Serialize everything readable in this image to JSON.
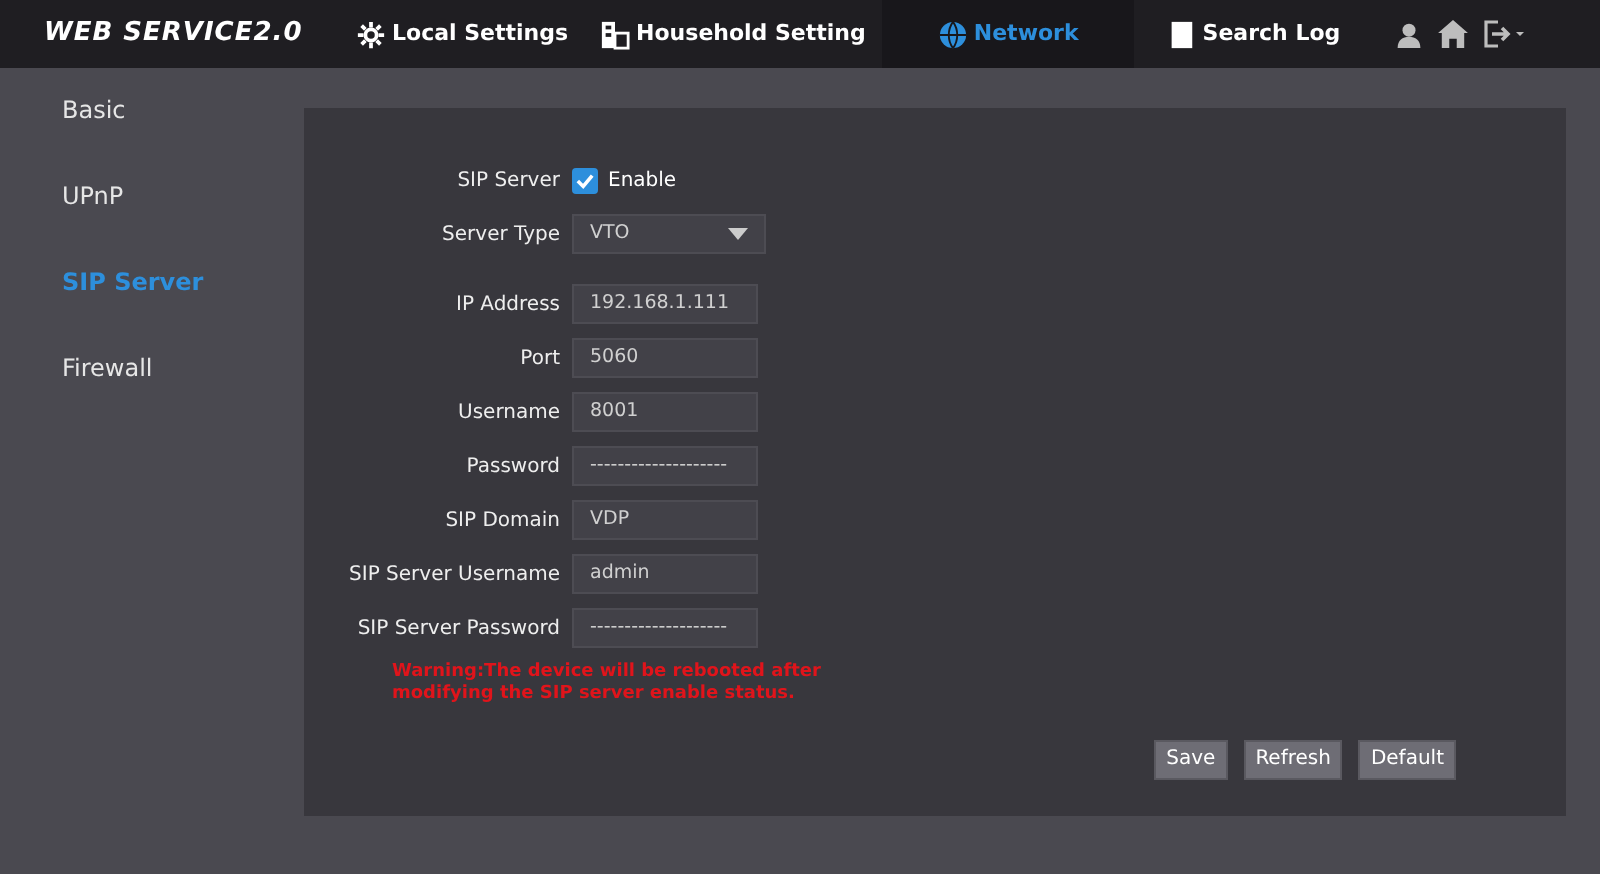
{
  "brand": "WEB SERVICE2.0",
  "nav": [
    {
      "label": "Local Settings",
      "selected": false
    },
    {
      "label": "Household Setting",
      "selected": false
    },
    {
      "label": "Network",
      "selected": true
    },
    {
      "label": "Search Log",
      "selected": false
    }
  ],
  "sidebar": {
    "items": [
      {
        "label": "Basic",
        "selected": false
      },
      {
        "label": "UPnP",
        "selected": false
      },
      {
        "label": "SIP Server",
        "selected": true
      },
      {
        "label": "Firewall",
        "selected": false
      }
    ]
  },
  "form": {
    "fields": [
      {
        "kind": "checkbox",
        "label": "SIP Server",
        "option": "Enable",
        "checked": true
      },
      {
        "kind": "select",
        "label": "Server Type",
        "value": "VTO"
      },
      {
        "kind": "text",
        "label": "IP Address",
        "value": "192.168.1.111"
      },
      {
        "kind": "text",
        "label": "Port",
        "value": "5060"
      },
      {
        "kind": "text",
        "label": "Username",
        "value": "8001"
      },
      {
        "kind": "text",
        "label": "Password",
        "value": "--------------------"
      },
      {
        "kind": "text",
        "label": "SIP Domain",
        "value": "VDP"
      },
      {
        "kind": "text",
        "label": "SIP Server Username",
        "value": "admin"
      },
      {
        "kind": "text",
        "label": "SIP Server Password",
        "value": "--------------------"
      }
    ],
    "warning": "Warning:The device will be rebooted after modifying the SIP server enable status.",
    "buttons": [
      "Save",
      "Refresh",
      "Default"
    ]
  }
}
